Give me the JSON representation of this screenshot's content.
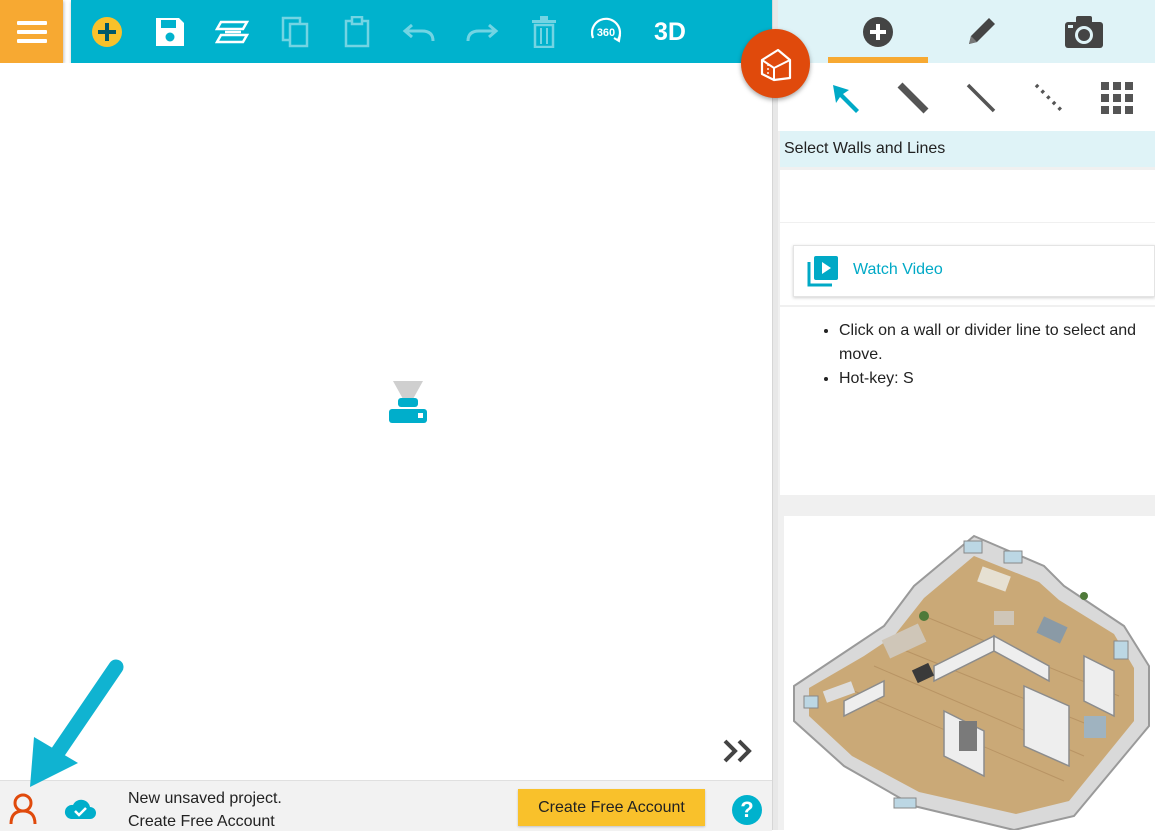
{
  "toolbar": {
    "icons": [
      "menu-icon",
      "add-icon",
      "save-icon",
      "floors-icon",
      "copy-icon",
      "paste-icon",
      "undo-icon",
      "redo-icon",
      "delete-icon",
      "360-icon"
    ],
    "label_360": "360",
    "label_3d": "3D"
  },
  "mode_tabs": [
    {
      "name": "add-mode",
      "icon": "plus-circle-icon",
      "active": true
    },
    {
      "name": "edit-mode",
      "icon": "pencil-icon",
      "active": false
    },
    {
      "name": "snapshot-mode",
      "icon": "camera-icon",
      "active": false
    }
  ],
  "tools": [
    "select-arrow-icon",
    "wall-tool-icon",
    "line-tool-icon",
    "dotted-line-tool-icon",
    "grid-icon"
  ],
  "panel": {
    "section_title": "Select Walls and Lines",
    "watch_video_label": "Watch Video",
    "instructions": [
      "Click on a wall or divider line to select and move.",
      "Hot-key: S"
    ]
  },
  "status": {
    "line1": "New unsaved project.",
    "line2": "Create Free Account"
  },
  "create_button_label": "Create Free Account",
  "help_label": "?",
  "colors": {
    "accent": "#00b2cd",
    "orange": "#f7a932",
    "fab": "#e04a0c",
    "button_yellow": "#f9c12b"
  }
}
